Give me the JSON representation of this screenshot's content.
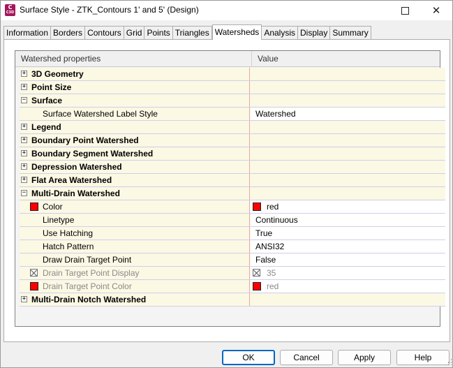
{
  "window": {
    "title": "Surface Style - ZTK_Contours 1' and 5' (Design)",
    "app_icon_letter": "C",
    "app_icon_sub": "C3D",
    "restore_glyph": "",
    "close_glyph": "✕"
  },
  "tabs": [
    {
      "label": "Information",
      "active": false
    },
    {
      "label": "Borders",
      "active": false
    },
    {
      "label": "Contours",
      "active": false
    },
    {
      "label": "Grid",
      "active": false
    },
    {
      "label": "Points",
      "active": false
    },
    {
      "label": "Triangles",
      "active": false
    },
    {
      "label": "Watersheds",
      "active": true
    },
    {
      "label": "Analysis",
      "active": false
    },
    {
      "label": "Display",
      "active": false
    },
    {
      "label": "Summary",
      "active": false
    }
  ],
  "grid": {
    "header": {
      "property": "Watershed properties",
      "value": "Value"
    },
    "rows": [
      {
        "type": "group",
        "expander": "+",
        "label": "3D Geometry",
        "value": ""
      },
      {
        "type": "group",
        "expander": "+",
        "label": "Point Size",
        "value": ""
      },
      {
        "type": "group",
        "expander": "−",
        "label": "Surface",
        "value": ""
      },
      {
        "type": "child",
        "label": "Surface Watershed Label Style",
        "value": "Watershed"
      },
      {
        "type": "group",
        "expander": "+",
        "label": "Legend",
        "value": ""
      },
      {
        "type": "group",
        "expander": "+",
        "label": "Boundary Point Watershed",
        "value": ""
      },
      {
        "type": "group",
        "expander": "+",
        "label": "Boundary Segment Watershed",
        "value": ""
      },
      {
        "type": "group",
        "expander": "+",
        "label": "Depression Watershed",
        "value": ""
      },
      {
        "type": "group",
        "expander": "+",
        "label": "Flat Area Watershed",
        "value": ""
      },
      {
        "type": "group",
        "expander": "−",
        "label": "Multi-Drain Watershed",
        "value": ""
      },
      {
        "type": "child",
        "label": "Color",
        "value": "red",
        "prop_icon": "color-swatch",
        "val_icon": "color-swatch"
      },
      {
        "type": "child",
        "label": "Linetype",
        "value": "Continuous"
      },
      {
        "type": "child",
        "label": "Use Hatching",
        "value": "True"
      },
      {
        "type": "child",
        "label": "Hatch Pattern",
        "value": "ANSI32"
      },
      {
        "type": "child",
        "label": "Draw Drain Target Point",
        "value": "False"
      },
      {
        "type": "child",
        "label": "Drain Target Point Display",
        "value": "35",
        "disabled": true,
        "prop_icon": "lock",
        "val_icon": "lock"
      },
      {
        "type": "child",
        "label": "Drain Target Point Color",
        "value": "red",
        "disabled": true,
        "prop_icon": "color-swatch",
        "val_icon": "color-swatch"
      },
      {
        "type": "group",
        "expander": "+",
        "label": "Multi-Drain Notch Watershed",
        "value": ""
      }
    ]
  },
  "buttons": {
    "ok": "OK",
    "cancel": "Cancel",
    "apply": "Apply",
    "help": "Help"
  },
  "colors": {
    "swatch_red": "#ff0000",
    "row_bg": "#fbf8e4",
    "accent": "#0067c0"
  }
}
